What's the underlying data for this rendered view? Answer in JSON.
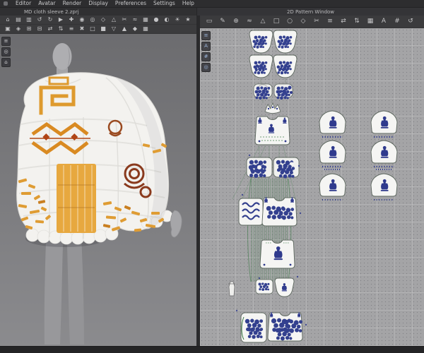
{
  "app": {
    "menu_items": [
      "Editor",
      "Avatar",
      "Render",
      "Display",
      "Preferences",
      "Settings",
      "Help"
    ],
    "project_title": "MD cloth sleeve 2.zprj",
    "pattern_window_title": "2D Pattern Window"
  },
  "toolbars": {
    "left_row1": [
      {
        "name": "home",
        "glyph": "⌂"
      },
      {
        "name": "open-project",
        "glyph": "▤"
      },
      {
        "name": "save-project",
        "glyph": "▥"
      },
      {
        "name": "undo",
        "glyph": "↺"
      },
      {
        "name": "redo",
        "glyph": "↻"
      },
      {
        "name": "simulate",
        "glyph": "▶"
      },
      {
        "name": "select-move",
        "glyph": "✚"
      },
      {
        "name": "pin",
        "glyph": "◉"
      },
      {
        "name": "rotate-gizmo",
        "glyph": "◎"
      },
      {
        "name": "scale-gizmo",
        "glyph": "◇"
      },
      {
        "name": "measure",
        "glyph": "△"
      },
      {
        "name": "scissors",
        "glyph": "✂"
      },
      {
        "name": "sewing",
        "glyph": "≈"
      },
      {
        "name": "fabric",
        "glyph": "▦"
      },
      {
        "name": "avatar",
        "glyph": "●"
      },
      {
        "name": "camera",
        "glyph": "◐"
      },
      {
        "name": "light",
        "glyph": "☀"
      },
      {
        "name": "render",
        "glyph": "★"
      }
    ],
    "left_row2": [
      {
        "name": "show-garment",
        "glyph": "▣"
      },
      {
        "name": "show-avatar",
        "glyph": "◈"
      },
      {
        "name": "show-seams",
        "glyph": "⊞"
      },
      {
        "name": "show-pins",
        "glyph": "⊟"
      },
      {
        "name": "sync-view",
        "glyph": "⇄"
      },
      {
        "name": "layer-order",
        "glyph": "⇅"
      },
      {
        "name": "view-menu",
        "glyph": "≡"
      },
      {
        "name": "delete",
        "glyph": "✖"
      },
      {
        "name": "wireframe",
        "glyph": "□"
      },
      {
        "name": "shaded-view",
        "glyph": "■"
      },
      {
        "name": "gravity-toggle",
        "glyph": "▽"
      },
      {
        "name": "collision-toggle",
        "glyph": "▲"
      },
      {
        "name": "strain-map",
        "glyph": "◆"
      },
      {
        "name": "texture-view",
        "glyph": "▦"
      }
    ],
    "right_row": [
      {
        "name": "transform-pattern",
        "glyph": "▭"
      },
      {
        "name": "edit-pattern",
        "glyph": "✎"
      },
      {
        "name": "add-point",
        "glyph": "⊕"
      },
      {
        "name": "edit-curve",
        "glyph": "≈"
      },
      {
        "name": "polygon-tool",
        "glyph": "△"
      },
      {
        "name": "rectangle-tool",
        "glyph": "□"
      },
      {
        "name": "circle-tool",
        "glyph": "○"
      },
      {
        "name": "dart-tool",
        "glyph": "◇"
      },
      {
        "name": "cut-tool",
        "glyph": "✂"
      },
      {
        "name": "segment-sewing",
        "glyph": "≡"
      },
      {
        "name": "free-sewing",
        "glyph": "⇄"
      },
      {
        "name": "sewing-direction",
        "glyph": "⇅"
      },
      {
        "name": "texture-editor",
        "glyph": "▦"
      },
      {
        "name": "annotation",
        "glyph": "A"
      },
      {
        "name": "grid-toggle",
        "glyph": "#"
      },
      {
        "name": "resync-2d",
        "glyph": "↺"
      }
    ],
    "left_vertical": [
      {
        "name": "viewport-menu",
        "glyph": "≡"
      },
      {
        "name": "zoom-mode",
        "glyph": "◎"
      },
      {
        "name": "reset-camera",
        "glyph": "⌂"
      }
    ],
    "right_vertical": [
      {
        "name": "pattern-menu",
        "glyph": "≡"
      },
      {
        "name": "annotation-2d",
        "glyph": "A"
      },
      {
        "name": "snap-grid",
        "glyph": "#"
      },
      {
        "name": "zoom-2d",
        "glyph": "◎"
      }
    ]
  },
  "colors": {
    "accent_orange": "#e09a2e",
    "embroidery_navy": "#33408f",
    "stitch_green": "#3c7a46",
    "panel_dark": "#2d2d2f",
    "toolbar": "#3b3b3d",
    "viewport_3d": "#7b7b7e",
    "pattern_background": "#a4a4a6"
  }
}
